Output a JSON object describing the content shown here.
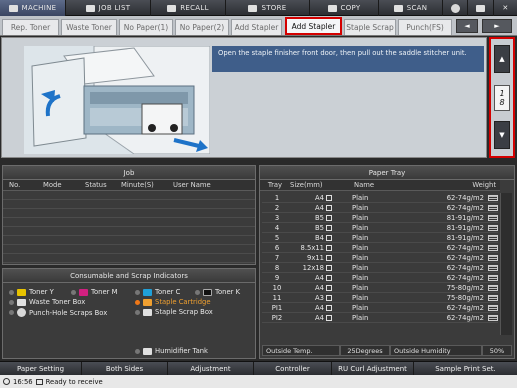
{
  "topbar": {
    "items": [
      "MACHINE",
      "JOB LIST",
      "RECALL",
      "STORE",
      "COPY",
      "SCAN"
    ],
    "globe_label": "",
    "close_label": "✕"
  },
  "tabs": {
    "items": [
      "Rep. Toner",
      "Waste Toner",
      "No Paper(1)",
      "No Paper(2)",
      "Add Stapler",
      "Staple Scrap",
      "Punch(FS)"
    ],
    "prev": "◄",
    "next": "►"
  },
  "guide": {
    "message": "Open the staple finisher front door, then pull out the saddle stitcher unit.",
    "page_current": "1",
    "page_total": "8",
    "up_label": "▲",
    "down_label": "▼"
  },
  "job": {
    "title": "Job",
    "columns": [
      "No.",
      "Mode",
      "Status",
      "Minute(S)",
      "User Name"
    ]
  },
  "consumables": {
    "title": "Consumable and Scrap Indicators",
    "items": [
      "Toner Y",
      "Toner M",
      "Toner C",
      "Toner K",
      "Waste Toner Box",
      "Staple Cartridge",
      "Punch-Hole Scraps Box",
      "Staple Scrap Box",
      "Humidifier Tank"
    ]
  },
  "tray": {
    "title": "Paper Tray",
    "columns": [
      "Tray",
      "Size(mm)",
      "Name",
      "Weight"
    ],
    "rows": [
      {
        "tray": "1",
        "size": "A4",
        "name": "Plain",
        "weight": "62-74g/m2"
      },
      {
        "tray": "2",
        "size": "A4",
        "name": "Plain",
        "weight": "62-74g/m2"
      },
      {
        "tray": "3",
        "size": "B5",
        "name": "Plain",
        "weight": "81-91g/m2"
      },
      {
        "tray": "4",
        "size": "B5",
        "name": "Plain",
        "weight": "81-91g/m2"
      },
      {
        "tray": "5",
        "size": "B4",
        "name": "Plain",
        "weight": "81-91g/m2"
      },
      {
        "tray": "6",
        "size": "8.5x11",
        "name": "Plain",
        "weight": "62-74g/m2"
      },
      {
        "tray": "7",
        "size": "9x11",
        "name": "Plain",
        "weight": "62-74g/m2"
      },
      {
        "tray": "8",
        "size": "12x18",
        "name": "Plain",
        "weight": "62-74g/m2"
      },
      {
        "tray": "9",
        "size": "A4",
        "name": "Plain",
        "weight": "62-74g/m2"
      },
      {
        "tray": "10",
        "size": "A4",
        "name": "Plain",
        "weight": "75-80g/m2"
      },
      {
        "tray": "11",
        "size": "A3",
        "name": "Plain",
        "weight": "75-80g/m2"
      },
      {
        "tray": "PI1",
        "size": "A4",
        "name": "Plain",
        "weight": "62-74g/m2"
      },
      {
        "tray": "PI2",
        "size": "A4",
        "name": "Plain",
        "weight": "62-74g/m2"
      }
    ],
    "outside_temp_label": "Outside Temp.",
    "outside_temp_value": "25Degrees",
    "outside_humidity_label": "Outside Humidity",
    "outside_humidity_value": "50%"
  },
  "bottombar": {
    "items": [
      "Paper Setting",
      "Both Sides",
      "Adjustment",
      "Controller",
      "RU Curl Adjustment",
      "Sample Print Set."
    ]
  },
  "status": {
    "time": "16:56",
    "text": "Ready to receive"
  },
  "colors": {
    "highlight": "#d40000",
    "message_bg": "#3f5e8a",
    "warn": "#f0a030"
  }
}
